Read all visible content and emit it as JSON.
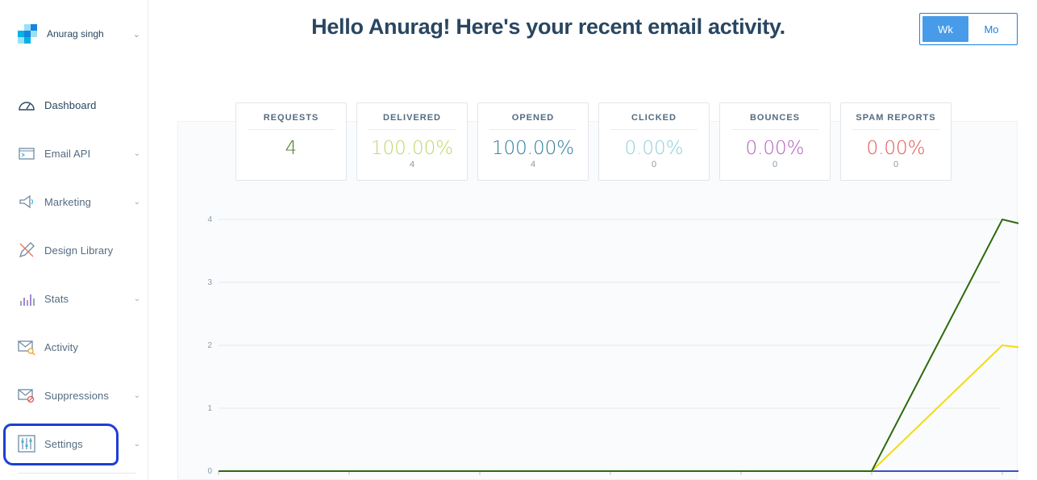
{
  "account": {
    "name": "Anurag singh"
  },
  "sidebar": {
    "items": [
      {
        "label": "Dashboard",
        "icon": "speedometer-icon"
      },
      {
        "label": "Email API",
        "icon": "terminal-icon"
      },
      {
        "label": "Marketing",
        "icon": "megaphone-icon"
      },
      {
        "label": "Design Library",
        "icon": "pencil-ruler-icon"
      },
      {
        "label": "Stats",
        "icon": "bar-chart-icon"
      },
      {
        "label": "Activity",
        "icon": "envelope-search-icon"
      },
      {
        "label": "Suppressions",
        "icon": "envelope-block-icon"
      },
      {
        "label": "Settings",
        "icon": "sliders-icon"
      }
    ]
  },
  "header": {
    "title": "Hello Anurag! Here's your recent email activity."
  },
  "period": {
    "week": "Wk",
    "month": "Mo",
    "selected": "Wk"
  },
  "stats": [
    {
      "label": "REQUESTS",
      "value": "4",
      "sub": "",
      "color": "#4a7a2a"
    },
    {
      "label": "DELIVERED",
      "value": "100.00%",
      "sub": "4",
      "color": "#bcd86a"
    },
    {
      "label": "OPENED",
      "value": "100.00%",
      "sub": "4",
      "color": "#2f7d97"
    },
    {
      "label": "CLICKED",
      "value": "0.00%",
      "sub": "0",
      "color": "#8ecfdb"
    },
    {
      "label": "BOUNCES",
      "value": "0.00%",
      "sub": "0",
      "color": "#b45dc0"
    },
    {
      "label": "SPAM REPORTS",
      "value": "0.00%",
      "sub": "0",
      "color": "#e35454"
    }
  ],
  "colors": {
    "accent": "#1a82e2",
    "requests_line": "#2d6a0e",
    "delivered_line": "#f0dc0f",
    "zero_line": "#3a4fc4"
  },
  "chart_data": {
    "type": "line",
    "y_ticks": [
      "0",
      "1",
      "2",
      "3",
      "4"
    ],
    "ylim": [
      0,
      4
    ],
    "x_count": 8,
    "series": [
      {
        "values": [
          0,
          0,
          0,
          0,
          0,
          0,
          4,
          3.5
        ],
        "color": "#2d6a0e"
      },
      {
        "values": [
          0,
          0,
          0,
          0,
          0,
          0,
          2,
          1.75
        ],
        "color": "#f0dc0f"
      },
      {
        "values": [
          0,
          0,
          0,
          0,
          0,
          0,
          0,
          0
        ],
        "color": "#3a4fc4"
      }
    ]
  }
}
